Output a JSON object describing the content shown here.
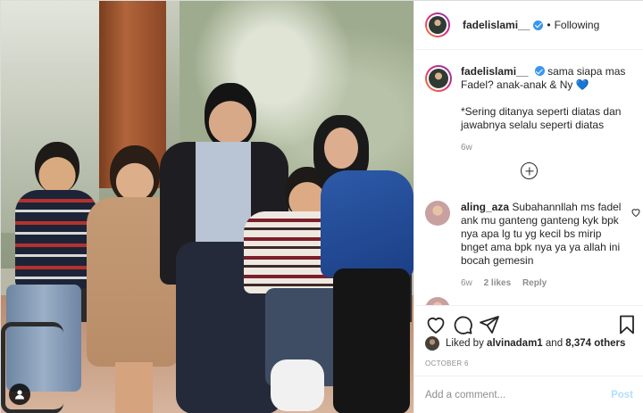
{
  "header": {
    "username": "fadelislami__",
    "separator": "•",
    "follow_status": "Following"
  },
  "caption": {
    "username": "fadelislami__",
    "text": "sama siapa mas Fadel? anak-anak & Ny 💙",
    "note": "*Sering ditanya seperti diatas dan jawabnya selalu seperti diatas",
    "age": "6w"
  },
  "comments": [
    {
      "username": "aling_aza",
      "text": "Subahannllah ms fadel ank mu ganteng ganteng kyk bpk nya apa lg tu yg kecil bs mirip bnget ama bpk nya ya ya allah ini bocah gemesin",
      "age": "6w",
      "likes": "2 likes",
      "reply": "Reply"
    }
  ],
  "icons": {
    "like": "heart-icon",
    "comment": "comment-icon",
    "share": "paper-plane-icon",
    "save": "bookmark-icon",
    "load_more": "plus-circle-icon",
    "tag": "user-tag-icon",
    "verified": "verified-badge-icon"
  },
  "likes": {
    "prefix": "Liked by",
    "first_user": "alvinadam1",
    "conjunction": "and",
    "others": "8,374 others"
  },
  "date": "OCTOBER 6",
  "add_comment": {
    "placeholder": "Add a comment...",
    "post_label": "Post"
  },
  "colors": {
    "accent": "#3897f0",
    "post_disabled": "#b2dffc",
    "muted": "#8e8e8e",
    "text": "#262626"
  }
}
